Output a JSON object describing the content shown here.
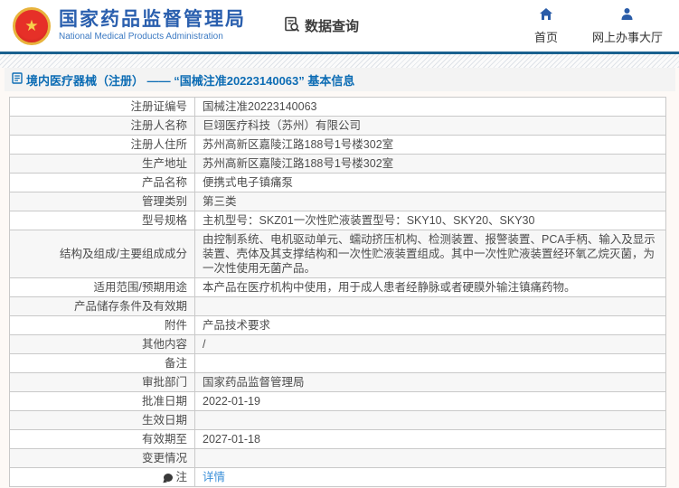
{
  "header": {
    "logo_title": "国家药品监督管理局",
    "logo_subtitle": "National Medical Products Administration",
    "data_query_label": "数据查询",
    "nav": [
      {
        "label": "首页"
      },
      {
        "label": "网上办事大厅"
      }
    ]
  },
  "breadcrumb": {
    "title": "境内医疗器械（注册） —— “国械注准20223140063” 基本信息"
  },
  "table": {
    "rows": [
      {
        "label": "注册证编号",
        "value": "国械注准20223140063"
      },
      {
        "label": "注册人名称",
        "value": "巨翊医疗科技（苏州）有限公司"
      },
      {
        "label": "注册人住所",
        "value": "苏州高新区嘉陵江路188号1号楼302室"
      },
      {
        "label": "生产地址",
        "value": "苏州高新区嘉陵江路188号1号楼302室"
      },
      {
        "label": "产品名称",
        "value": "便携式电子镇痛泵"
      },
      {
        "label": "管理类别",
        "value": "第三类"
      },
      {
        "label": "型号规格",
        "value": "主机型号：SKZ01一次性贮液装置型号：SKY10、SKY20、SKY30"
      },
      {
        "label": "结构及组成/主要组成成分",
        "value": "由控制系统、电机驱动单元、蠕动挤压机构、检测装置、报警装置、PCA手柄、输入及显示装置、壳体及其支撑结构和一次性贮液装置组成。其中一次性贮液装置经环氧乙烷灭菌，为一次性使用无菌产品。"
      },
      {
        "label": "适用范围/预期用途",
        "value": "本产品在医疗机构中使用，用于成人患者经静脉或者硬膜外输注镇痛药物。"
      },
      {
        "label": "产品储存条件及有效期",
        "value": ""
      },
      {
        "label": "附件",
        "value": "产品技术要求"
      },
      {
        "label": "其他内容",
        "value": "/"
      },
      {
        "label": "备注",
        "value": ""
      },
      {
        "label": "审批部门",
        "value": "国家药品监督管理局"
      },
      {
        "label": "批准日期",
        "value": "2022-01-19"
      },
      {
        "label": "生效日期",
        "value": ""
      },
      {
        "label": "有效期至",
        "value": "2027-01-18"
      },
      {
        "label": "变更情况",
        "value": ""
      },
      {
        "label": "注",
        "value": "详情",
        "link": true,
        "icon": "note-comment-icon"
      }
    ]
  },
  "colors": {
    "brand_blue": "#2a5fae",
    "divider_blue": "#1a618f",
    "breadcrumb_blue": "#0c6cb4",
    "link_blue": "#3b8fd8",
    "emblem_red": "#e63028",
    "emblem_gold": "#e8b33c"
  }
}
